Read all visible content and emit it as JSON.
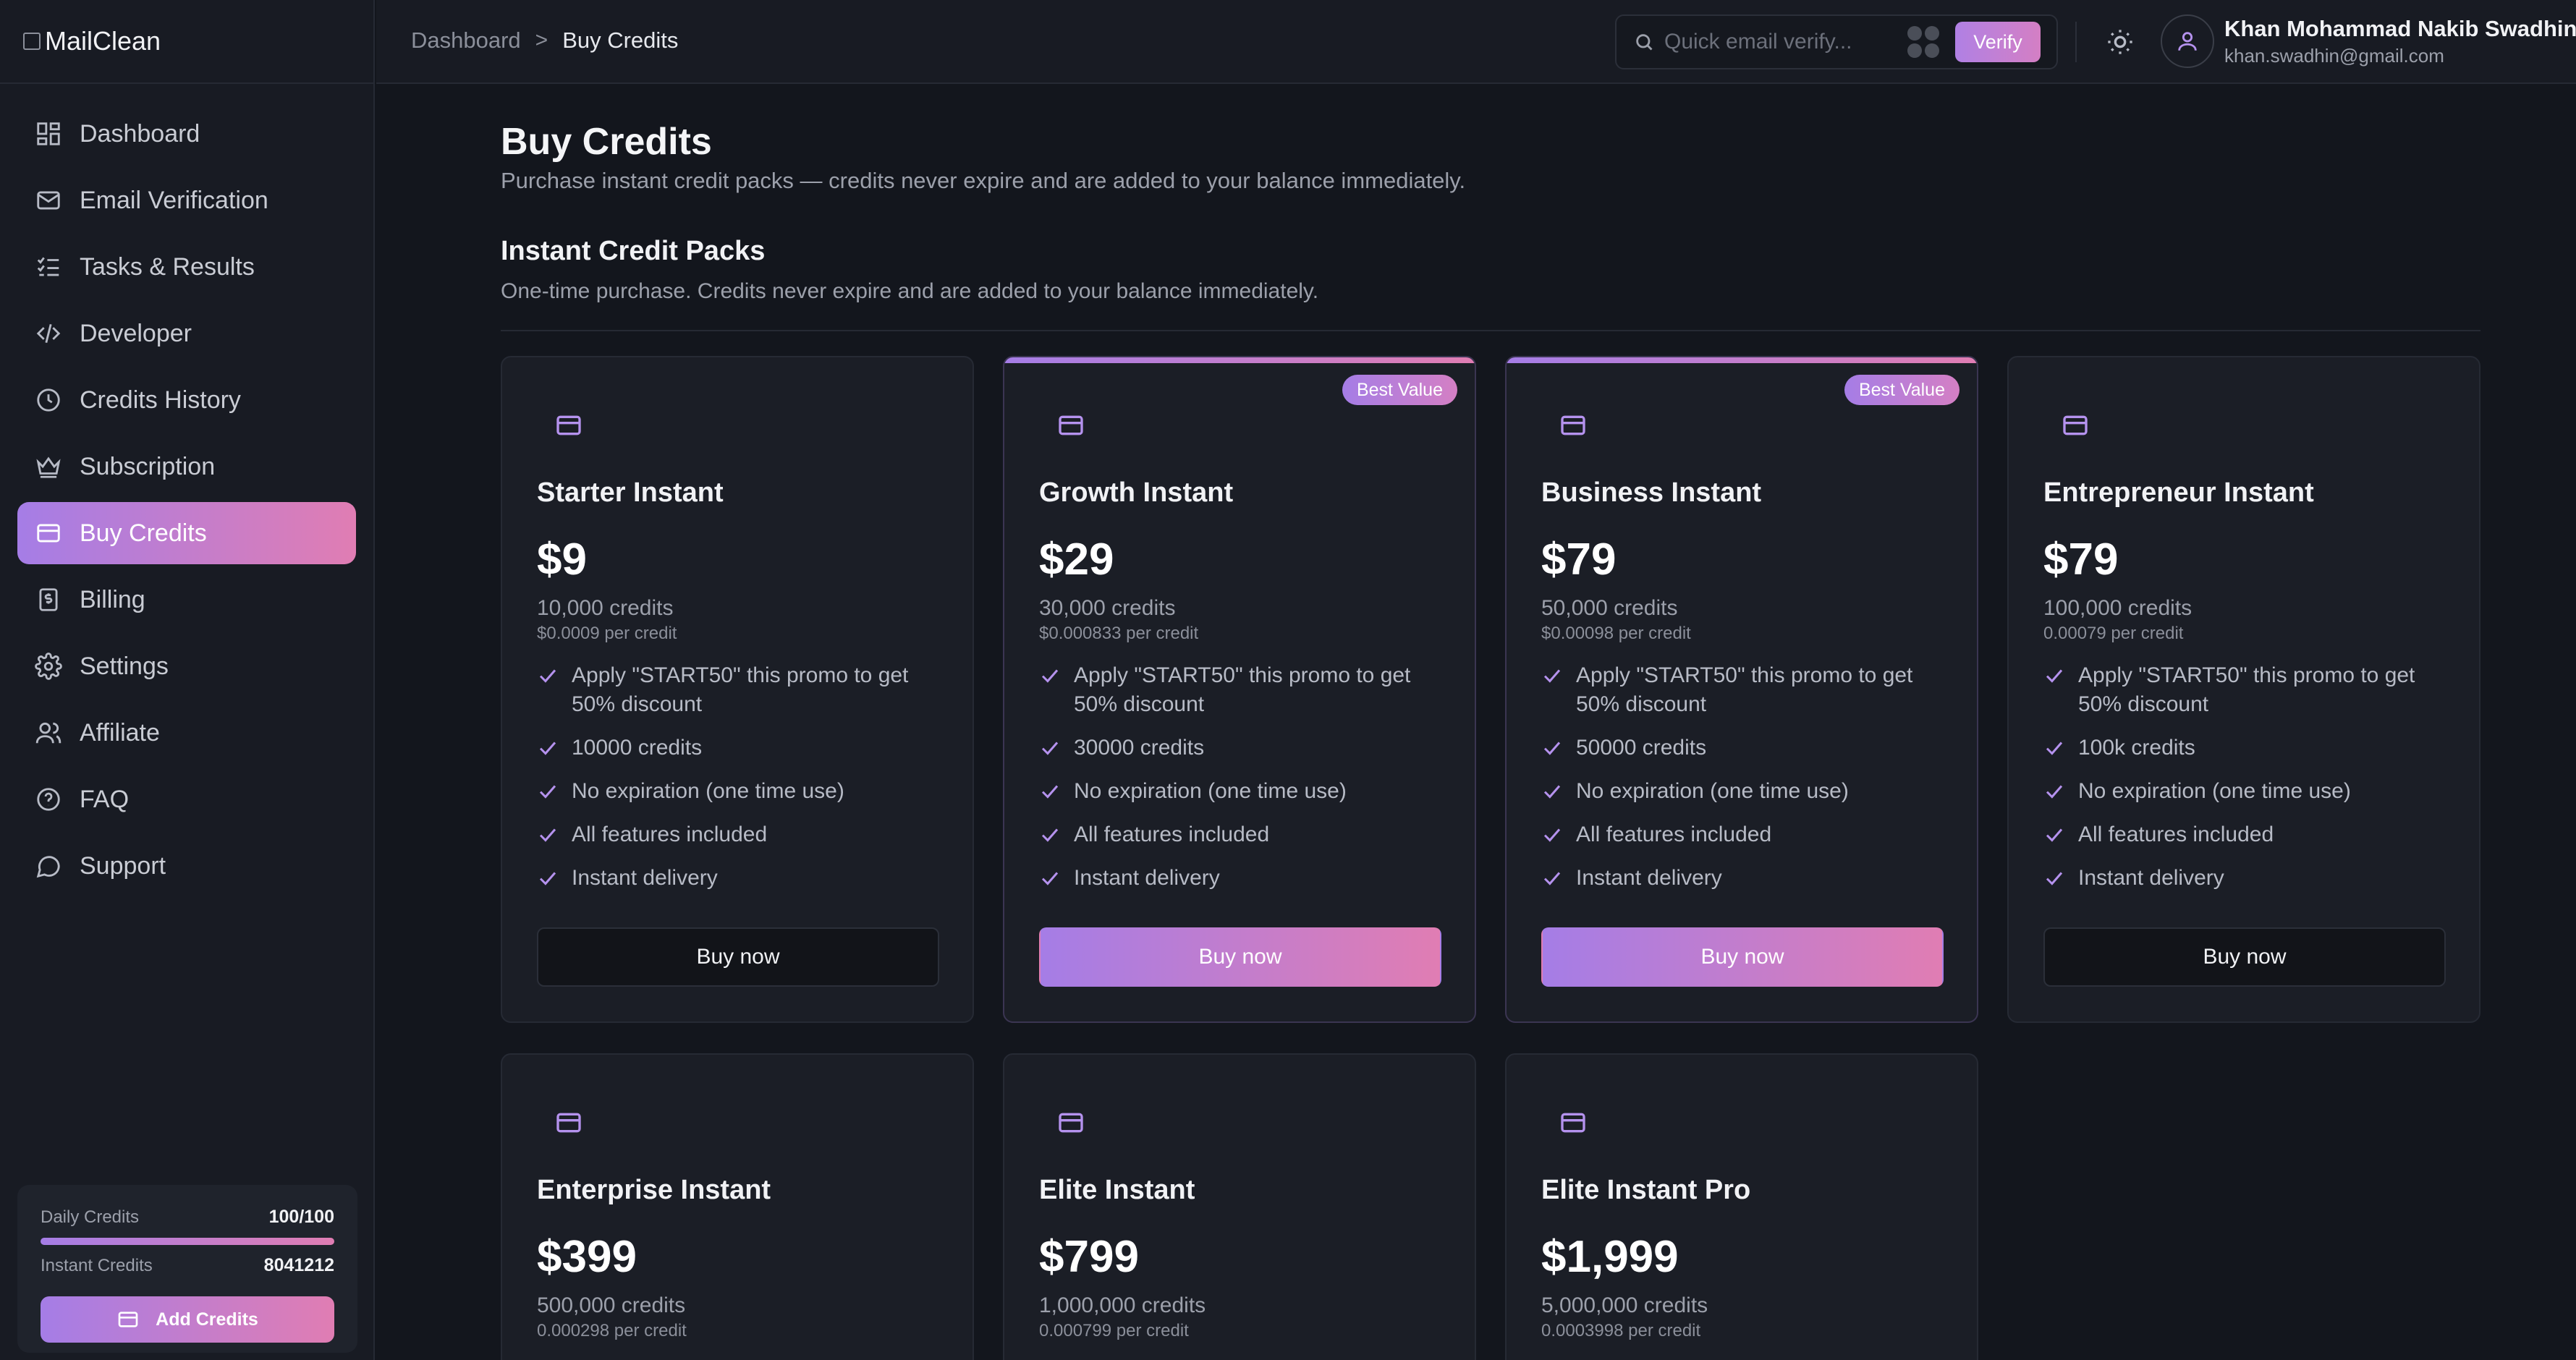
{
  "app": {
    "logo_text": "MailClean"
  },
  "sidebar": {
    "items": [
      {
        "label": "Dashboard",
        "icon": "dashboard-icon"
      },
      {
        "label": "Email Verification",
        "icon": "mail-icon"
      },
      {
        "label": "Tasks & Results",
        "icon": "list-check-icon"
      },
      {
        "label": "Developer",
        "icon": "code-icon"
      },
      {
        "label": "Credits History",
        "icon": "clock-icon"
      },
      {
        "label": "Subscription",
        "icon": "crown-icon"
      },
      {
        "label": "Buy Credits",
        "icon": "credit-card-icon",
        "active": true
      },
      {
        "label": "Billing",
        "icon": "receipt-dollar-icon"
      },
      {
        "label": "Settings",
        "icon": "gear-icon"
      },
      {
        "label": "Affiliate",
        "icon": "users-icon"
      },
      {
        "label": "FAQ",
        "icon": "help-circle-icon"
      },
      {
        "label": "Support",
        "icon": "chat-bubble-icon"
      }
    ],
    "credits": {
      "daily_label": "Daily Credits",
      "daily_value": "100/100",
      "daily_fraction": 1.0,
      "instant_label": "Instant Credits",
      "instant_value": "8041212",
      "add_button": "Add Credits"
    }
  },
  "header": {
    "breadcrumb": [
      "Dashboard",
      "Buy Credits"
    ],
    "breadcrumb_separator": ">",
    "search_placeholder": "Quick email verify...",
    "verify_button": "Verify",
    "user_name": "Khan Mohammad Nakib Swadhin",
    "user_email": "khan.swadhin@gmail.com"
  },
  "main": {
    "title": "Buy Credits",
    "subtitle": "Purchase instant credit packs — credits never expire and are added to your balance immediately.",
    "section_title": "Instant Credit Packs",
    "section_subtitle": "One-time purchase. Credits never expire and are added to your balance immediately.",
    "packs": [
      {
        "name": "Starter Instant",
        "price": "$9",
        "credits": "10,000 credits",
        "per_credit": "$0.0009 per credit",
        "badge": "",
        "highlight": false,
        "features": [
          "Apply \"START50\" this promo to get 50% discount",
          "10000 credits",
          "No expiration (one time use)",
          "All features included",
          "Instant delivery"
        ],
        "button": "Buy now"
      },
      {
        "name": "Growth Instant",
        "price": "$29",
        "credits": "30,000 credits",
        "per_credit": "$0.000833 per credit",
        "badge": "Best Value",
        "highlight": true,
        "features": [
          "Apply \"START50\" this promo to get 50% discount",
          "30000 credits",
          "No expiration (one time use)",
          "All features included",
          "Instant delivery"
        ],
        "button": "Buy now"
      },
      {
        "name": "Business Instant",
        "price": "$79",
        "credits": "50,000 credits",
        "per_credit": "$0.00098 per credit",
        "badge": "Best Value",
        "highlight": true,
        "features": [
          "Apply \"START50\" this promo to get 50% discount",
          "50000 credits",
          "No expiration (one time use)",
          "All features included",
          "Instant delivery"
        ],
        "button": "Buy now"
      },
      {
        "name": "Entrepreneur Instant",
        "price": "$79",
        "credits": "100,000 credits",
        "per_credit": "0.00079 per credit",
        "badge": "",
        "highlight": false,
        "features": [
          "Apply \"START50\" this promo to get 50% discount",
          "100k credits",
          "No expiration (one time use)",
          "All features included",
          "Instant delivery"
        ],
        "button": "Buy now"
      },
      {
        "name": "Enterprise Instant",
        "price": "$399",
        "credits": "500,000 credits",
        "per_credit": "0.000298 per credit",
        "badge": "",
        "highlight": false,
        "features": [],
        "button": ""
      },
      {
        "name": "Elite Instant",
        "price": "$799",
        "credits": "1,000,000 credits",
        "per_credit": "0.000799 per credit",
        "badge": "",
        "highlight": false,
        "features": [],
        "button": ""
      },
      {
        "name": "Elite Instant Pro",
        "price": "$1,999",
        "credits": "5,000,000 credits",
        "per_credit": "0.0003998 per credit",
        "badge": "",
        "highlight": false,
        "features": [],
        "button": ""
      }
    ]
  },
  "colors": {
    "background": "#13161d",
    "surface": "#1b1e26",
    "accent_start": "#a57de6",
    "accent_end": "#e07db3",
    "icon_accent": "#b592ee"
  }
}
